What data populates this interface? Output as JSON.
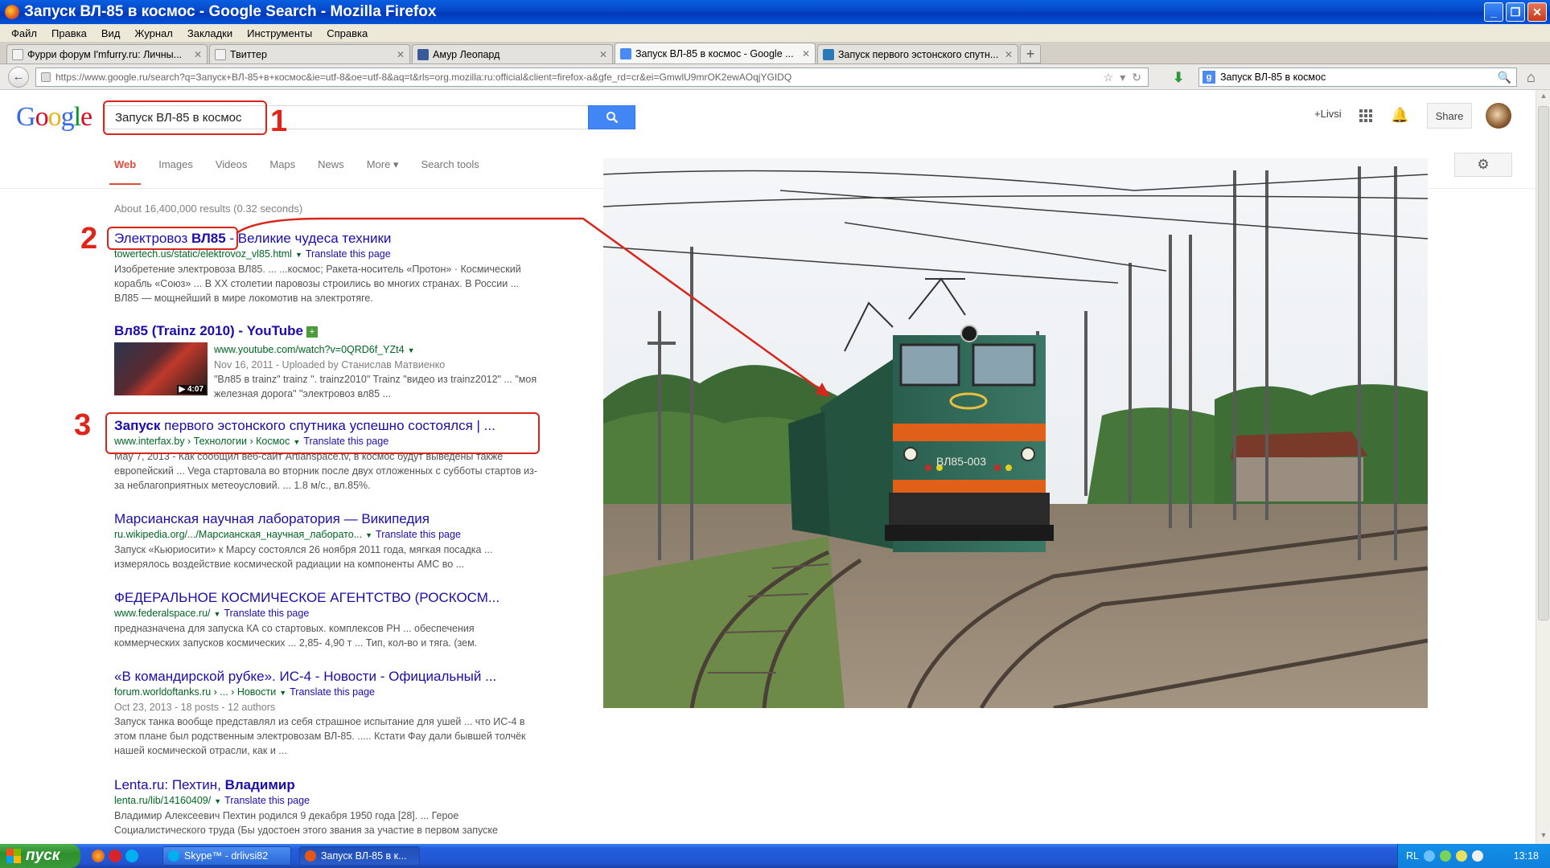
{
  "window": {
    "title": "Запуск ВЛ-85 в космос - Google Search - Mozilla Firefox",
    "buttons": [
      "_",
      "❐",
      "✕"
    ]
  },
  "menu": [
    "Файл",
    "Правка",
    "Вид",
    "Журнал",
    "Закладки",
    "Инструменты",
    "Справка"
  ],
  "tabs": [
    {
      "label": "Фурри форум I'mfurry.ru: Личны...",
      "icon_color": "#f2f2f2",
      "active": false
    },
    {
      "label": "Твиттер",
      "icon_color": "#f2f2f2",
      "active": false
    },
    {
      "label": "Амур Леопард",
      "icon_color": "#3b5998",
      "active": false
    },
    {
      "label": "Запуск ВЛ-85 в космос - Google ...",
      "icon_color": "#4a8af4",
      "active": true
    },
    {
      "label": "Запуск первого эстонского спутн...",
      "icon_color": "#2a7ab8",
      "active": false
    }
  ],
  "newtab": "+",
  "navbar": {
    "back": "←",
    "url": "https://www.google.ru/search?q=Запуск+ВЛ-85+в+космос&ie=utf-8&oe=utf-8&aq=t&rls=org.mozilla:ru:official&client=firefox-a&gfe_rd=cr&ei=GmwlU9mrOK2ewAOqjYGIDQ",
    "star": "☆",
    "reload": "↻",
    "dropdown": "▾",
    "download": "⬇",
    "search_text": "Запуск ВЛ-85 в космос",
    "search_engine": "g",
    "magnifier": "🔍",
    "home": "⌂"
  },
  "google": {
    "logo": [
      "G",
      "o",
      "o",
      "g",
      "l",
      "e"
    ],
    "query": "Запуск ВЛ-85 в космос",
    "plus_user": "+Livsi",
    "share": "Share",
    "bell": "🔔",
    "gear": "⚙",
    "nav_tabs": [
      "Web",
      "Images",
      "Videos",
      "Maps",
      "News",
      "More ▾",
      "Search tools"
    ],
    "result_stats": "About 16,400,000 results (0.32 seconds)"
  },
  "results": [
    {
      "title_pre": "Электровоз ",
      "title_bold": "ВЛ85",
      "title_post": " - Великие чудеса техники",
      "url": "towertech.us/static/elektrovoz_vl85.html",
      "translate": "Translate this page",
      "snippet": "Изобретение электровоза ВЛ85. ... ...космос; Ракета-носитель «Протон» · Космический корабль «Союз» ... В XX столетии паровозы строились во многих странах. В России ... ВЛ85 — мощнейший в мире локомотив на электротяге."
    },
    {
      "title": "Вл85 (Trainz 2010) - YouTube",
      "plus": "+",
      "url": "www.youtube.com/watch?v=0QRD6f_YZt4",
      "meta": "Nov 16, 2011 - Uploaded by Станислав Матвиенко",
      "snippet": "\"Вл85 в trainz\" trainz \". trainz2010\" Trainz \"видео из trainz2012\" ... \"моя железная дорога\" \"электровоз вл85 ...",
      "duration": "▶ 4:07"
    },
    {
      "title_bold": "Запуск",
      "title_post": " первого эстонского спутника успешно состоялся | ...",
      "url": "www.interfax.by › Технологии › Космос",
      "translate": "Translate this page",
      "snippet": "May 7, 2013 - Как сообщил веб-сайт Artianspace.tv, в космос будут выведены также европейский ... Vega стартовала во вторник после двух отложенных с субботы стартов из-за неблагоприятных метеоусловий. ... 1.8 м/с., вл.85%."
    },
    {
      "title": "Марсианская научная лаборатория — Википедия",
      "url": "ru.wikipedia.org/.../Марсианская_научная_лаборато...",
      "translate": "Translate this page",
      "snippet": "Запуск «Кьюриосити» к Марсу состоялся 26 ноября 2011 года, мягкая посадка ... измерялось воздействие космической радиации на компоненты АМС во ..."
    },
    {
      "title": "ФЕДЕРАЛЬНОЕ КОСМИЧЕСКОЕ АГЕНТСТВО (РОСКОСМ...",
      "url": "www.federalspace.ru/",
      "translate": "Translate this page",
      "snippet": "предназначена для запуска КА со стартовых. комплексов РН ... обеспечения коммерческих запусков космических ... 2,85- 4,90 т ... Тип, кол-во и тяга. (зем."
    },
    {
      "title": "«В командирской рубке». ИС-4 - Новости - Официальный ...",
      "url": "forum.worldoftanks.ru › ... › Новости",
      "translate": "Translate this page",
      "meta": "Oct 23, 2013 - 18 posts - 12 authors",
      "snippet": "Запуск танка вообще представлял из себя страшное испытание для ушей ... что ИС-4 в этом плане был родственным электровозам ВЛ-85. ..... Кстати Фау дали бывшей толчёк нашей космической отрасли, как и ..."
    },
    {
      "title_pre": "Lenta.ru: Пехтин, ",
      "title_bold": "Владимир",
      "url": "lenta.ru/lib/14160409/",
      "translate": "Translate this page",
      "snippet": "Владимир Алексеевич Пехтин родился 9 декабря 1950 года [28]. ... Герое Социалистического труда (Бы удостоен этого звания за участие в первом запуске"
    }
  ],
  "annotations": [
    "1",
    "2",
    "3"
  ],
  "photo": {
    "locomotive_number": "ВЛ85-003"
  },
  "taskbar": {
    "start": "пуск",
    "buttons": [
      {
        "label": "Skype™ - drlivsi82",
        "icon_color": "#00aff0",
        "active": false
      },
      {
        "label": "Запуск ВЛ-85 в к...",
        "icon_color": "#e4561a",
        "active": true
      }
    ],
    "lang": "RL",
    "clock": "13:18"
  }
}
